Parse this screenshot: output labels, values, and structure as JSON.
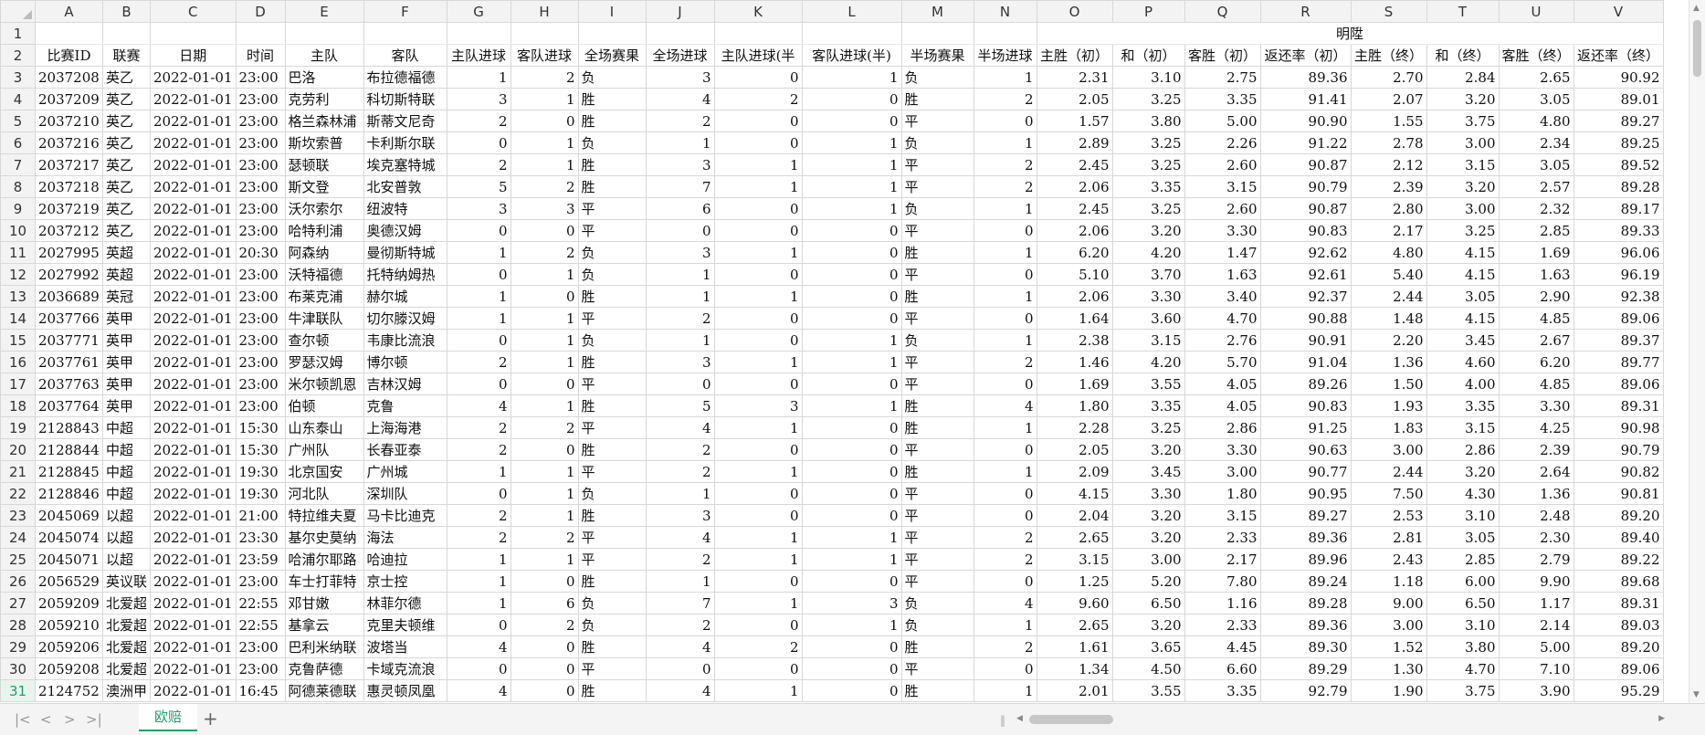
{
  "columns": [
    "A",
    "B",
    "C",
    "D",
    "E",
    "F",
    "G",
    "H",
    "I",
    "J",
    "K",
    "L",
    "M",
    "N",
    "O",
    "P",
    "Q",
    "R",
    "S",
    "T",
    "U",
    "V"
  ],
  "row1_merged_label": "明陞",
  "headers": [
    "比赛ID",
    "联赛",
    "日期",
    "时间",
    "主队",
    "客队",
    "主队进球",
    "客队进球",
    "全场赛果",
    "全场进球",
    "主队进球(半",
    "客队进球(半)",
    "半场赛果",
    "半场进球",
    "主胜（初）",
    "和（初）",
    "客胜（初）",
    "返还率（初）",
    "主胜（终）",
    "和（终）",
    "客胜（终）",
    "返还率（终）"
  ],
  "rows": [
    [
      "2037208",
      "英乙",
      "2022-01-01",
      "23:00",
      "巴洛",
      "布拉德福德",
      "1",
      "2",
      "负",
      "3",
      "0",
      "1",
      "负",
      "1",
      "2.31",
      "3.10",
      "2.75",
      "89.36",
      "2.70",
      "2.84",
      "2.65",
      "90.92"
    ],
    [
      "2037209",
      "英乙",
      "2022-01-01",
      "23:00",
      "克劳利",
      "科切斯特联",
      "3",
      "1",
      "胜",
      "4",
      "2",
      "0",
      "胜",
      "2",
      "2.05",
      "3.25",
      "3.35",
      "91.41",
      "2.07",
      "3.20",
      "3.05",
      "89.01"
    ],
    [
      "2037210",
      "英乙",
      "2022-01-01",
      "23:00",
      "格兰森林浦",
      "斯蒂文尼奇",
      "2",
      "0",
      "胜",
      "2",
      "0",
      "0",
      "平",
      "0",
      "1.57",
      "3.80",
      "5.00",
      "90.90",
      "1.55",
      "3.75",
      "4.80",
      "89.27"
    ],
    [
      "2037216",
      "英乙",
      "2022-01-01",
      "23:00",
      "斯坎索普",
      "卡利斯尔联",
      "0",
      "1",
      "负",
      "1",
      "0",
      "1",
      "负",
      "1",
      "2.89",
      "3.25",
      "2.26",
      "91.22",
      "2.78",
      "3.00",
      "2.34",
      "89.25"
    ],
    [
      "2037217",
      "英乙",
      "2022-01-01",
      "23:00",
      "瑟顿联",
      "埃克塞特城",
      "2",
      "1",
      "胜",
      "3",
      "1",
      "1",
      "平",
      "2",
      "2.45",
      "3.25",
      "2.60",
      "90.87",
      "2.12",
      "3.15",
      "3.05",
      "89.52"
    ],
    [
      "2037218",
      "英乙",
      "2022-01-01",
      "23:00",
      "斯文登",
      "北安普敦",
      "5",
      "2",
      "胜",
      "7",
      "1",
      "1",
      "平",
      "2",
      "2.06",
      "3.35",
      "3.15",
      "90.79",
      "2.39",
      "3.20",
      "2.57",
      "89.28"
    ],
    [
      "2037219",
      "英乙",
      "2022-01-01",
      "23:00",
      "沃尔索尔",
      "纽波特",
      "3",
      "3",
      "平",
      "6",
      "0",
      "1",
      "负",
      "1",
      "2.45",
      "3.25",
      "2.60",
      "90.87",
      "2.80",
      "3.00",
      "2.32",
      "89.17"
    ],
    [
      "2037212",
      "英乙",
      "2022-01-01",
      "23:00",
      "哈特利浦",
      "奥德汉姆",
      "0",
      "0",
      "平",
      "0",
      "0",
      "0",
      "平",
      "0",
      "2.06",
      "3.20",
      "3.30",
      "90.83",
      "2.17",
      "3.25",
      "2.85",
      "89.33"
    ],
    [
      "2027995",
      "英超",
      "2022-01-01",
      "20:30",
      "阿森纳",
      "曼彻斯特城",
      "1",
      "2",
      "负",
      "3",
      "1",
      "0",
      "胜",
      "1",
      "6.20",
      "4.20",
      "1.47",
      "92.62",
      "4.80",
      "4.15",
      "1.69",
      "96.06"
    ],
    [
      "2027992",
      "英超",
      "2022-01-01",
      "23:00",
      "沃特福德",
      "托特纳姆热",
      "0",
      "1",
      "负",
      "1",
      "0",
      "0",
      "平",
      "0",
      "5.10",
      "3.70",
      "1.63",
      "92.61",
      "5.40",
      "4.15",
      "1.63",
      "96.19"
    ],
    [
      "2036689",
      "英冠",
      "2022-01-01",
      "23:00",
      "布莱克浦",
      "赫尔城",
      "1",
      "0",
      "胜",
      "1",
      "1",
      "0",
      "胜",
      "1",
      "2.06",
      "3.30",
      "3.40",
      "92.37",
      "2.44",
      "3.05",
      "2.90",
      "92.38"
    ],
    [
      "2037766",
      "英甲",
      "2022-01-01",
      "23:00",
      "牛津联队",
      "切尔滕汉姆",
      "1",
      "1",
      "平",
      "2",
      "0",
      "0",
      "平",
      "0",
      "1.64",
      "3.60",
      "4.70",
      "90.88",
      "1.48",
      "4.15",
      "4.85",
      "89.06"
    ],
    [
      "2037771",
      "英甲",
      "2022-01-01",
      "23:00",
      "查尔顿",
      "韦康比流浪",
      "0",
      "1",
      "负",
      "1",
      "0",
      "1",
      "负",
      "1",
      "2.38",
      "3.15",
      "2.76",
      "90.91",
      "2.20",
      "3.45",
      "2.67",
      "89.37"
    ],
    [
      "2037761",
      "英甲",
      "2022-01-01",
      "23:00",
      "罗瑟汉姆",
      "博尔顿",
      "2",
      "1",
      "胜",
      "3",
      "1",
      "1",
      "平",
      "2",
      "1.46",
      "4.20",
      "5.70",
      "91.04",
      "1.36",
      "4.60",
      "6.20",
      "89.77"
    ],
    [
      "2037763",
      "英甲",
      "2022-01-01",
      "23:00",
      "米尔顿凯恩",
      "吉林汉姆",
      "0",
      "0",
      "平",
      "0",
      "0",
      "0",
      "平",
      "0",
      "1.69",
      "3.55",
      "4.05",
      "89.26",
      "1.50",
      "4.00",
      "4.85",
      "89.06"
    ],
    [
      "2037764",
      "英甲",
      "2022-01-01",
      "23:00",
      "伯顿",
      "克鲁",
      "4",
      "1",
      "胜",
      "5",
      "3",
      "1",
      "胜",
      "4",
      "1.80",
      "3.35",
      "4.05",
      "90.83",
      "1.93",
      "3.35",
      "3.30",
      "89.31"
    ],
    [
      "2128843",
      "中超",
      "2022-01-01",
      "15:30",
      "山东泰山",
      "上海海港",
      "2",
      "2",
      "平",
      "4",
      "1",
      "0",
      "胜",
      "1",
      "2.28",
      "3.25",
      "2.86",
      "91.25",
      "1.83",
      "3.15",
      "4.25",
      "90.98"
    ],
    [
      "2128844",
      "中超",
      "2022-01-01",
      "15:30",
      "广州队",
      "长春亚泰",
      "2",
      "0",
      "胜",
      "2",
      "0",
      "0",
      "平",
      "0",
      "2.05",
      "3.20",
      "3.30",
      "90.63",
      "3.00",
      "2.86",
      "2.39",
      "90.79"
    ],
    [
      "2128845",
      "中超",
      "2022-01-01",
      "19:30",
      "北京国安",
      "广州城",
      "1",
      "1",
      "平",
      "2",
      "1",
      "0",
      "胜",
      "1",
      "2.09",
      "3.45",
      "3.00",
      "90.77",
      "2.44",
      "3.20",
      "2.64",
      "90.82"
    ],
    [
      "2128846",
      "中超",
      "2022-01-01",
      "19:30",
      "河北队",
      "深圳队",
      "0",
      "1",
      "负",
      "1",
      "0",
      "0",
      "平",
      "0",
      "4.15",
      "3.30",
      "1.80",
      "90.95",
      "7.50",
      "4.30",
      "1.36",
      "90.81"
    ],
    [
      "2045069",
      "以超",
      "2022-01-01",
      "21:00",
      "特拉维夫夏",
      "马卡比迪克",
      "2",
      "1",
      "胜",
      "3",
      "0",
      "0",
      "平",
      "0",
      "2.04",
      "3.20",
      "3.15",
      "89.27",
      "2.53",
      "3.10",
      "2.48",
      "89.20"
    ],
    [
      "2045074",
      "以超",
      "2022-01-01",
      "23:30",
      "基尔史莫纳",
      "海法",
      "2",
      "2",
      "平",
      "4",
      "1",
      "1",
      "平",
      "2",
      "2.65",
      "3.20",
      "2.33",
      "89.36",
      "2.81",
      "3.05",
      "2.30",
      "89.40"
    ],
    [
      "2045071",
      "以超",
      "2022-01-01",
      "23:59",
      "哈浦尔耶路",
      "哈迪拉",
      "1",
      "1",
      "平",
      "2",
      "1",
      "1",
      "平",
      "2",
      "3.15",
      "3.00",
      "2.17",
      "89.96",
      "2.43",
      "2.85",
      "2.79",
      "89.22"
    ],
    [
      "2056529",
      "英议联",
      "2022-01-01",
      "23:00",
      "车士打菲特",
      "京士控",
      "1",
      "0",
      "胜",
      "1",
      "0",
      "0",
      "平",
      "0",
      "1.25",
      "5.20",
      "7.80",
      "89.24",
      "1.18",
      "6.00",
      "9.90",
      "89.68"
    ],
    [
      "2059209",
      "北爱超",
      "2022-01-01",
      "22:55",
      "邓甘嫩",
      "林菲尔德",
      "1",
      "6",
      "负",
      "7",
      "1",
      "3",
      "负",
      "4",
      "9.60",
      "6.50",
      "1.16",
      "89.28",
      "9.00",
      "6.50",
      "1.17",
      "89.31"
    ],
    [
      "2059210",
      "北爱超",
      "2022-01-01",
      "22:55",
      "基拿云",
      "克里夫顿维",
      "0",
      "2",
      "负",
      "2",
      "0",
      "1",
      "负",
      "1",
      "2.65",
      "3.20",
      "2.33",
      "89.36",
      "3.00",
      "3.10",
      "2.14",
      "89.03"
    ],
    [
      "2059206",
      "北爱超",
      "2022-01-01",
      "23:00",
      "巴利米纳联",
      "波塔当",
      "4",
      "0",
      "胜",
      "4",
      "2",
      "0",
      "胜",
      "2",
      "1.61",
      "3.65",
      "4.45",
      "89.30",
      "1.52",
      "3.80",
      "5.00",
      "89.20"
    ],
    [
      "2059208",
      "北爱超",
      "2022-01-01",
      "23:00",
      "克鲁萨德",
      "卡域克流浪",
      "0",
      "0",
      "平",
      "0",
      "0",
      "0",
      "平",
      "0",
      "1.34",
      "4.50",
      "6.60",
      "89.29",
      "1.30",
      "4.70",
      "7.10",
      "89.06"
    ],
    [
      "2124752",
      "澳洲甲",
      "2022-01-01",
      "16:45",
      "阿德莱德联",
      "惠灵顿凤凰",
      "4",
      "0",
      "胜",
      "4",
      "1",
      "0",
      "胜",
      "1",
      "2.01",
      "3.55",
      "3.35",
      "92.79",
      "1.90",
      "3.75",
      "3.90",
      "95.29"
    ]
  ],
  "active_row_number": "31",
  "sheet_tab": "欧赔",
  "add_sheet_icon": "plus-icon",
  "accent_color": "#1e9f6a"
}
